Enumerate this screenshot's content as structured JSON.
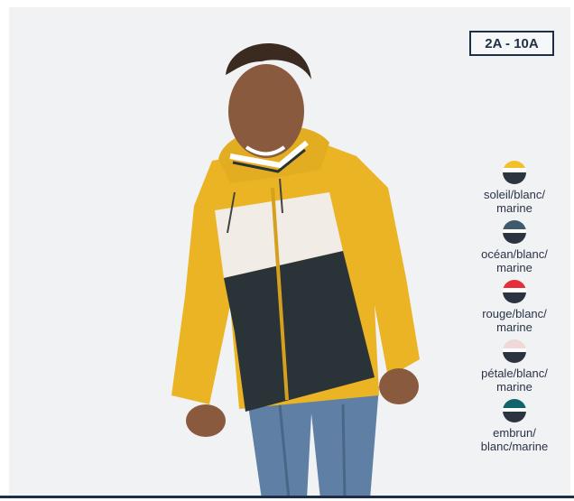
{
  "badge": {
    "size_range": "2A - 10A"
  },
  "colors": {
    "navy": "#1e2e45",
    "yellow": "#f2c12a",
    "slate": "#3f5a6b",
    "red": "#e5303a",
    "petal": "#f1d8d8",
    "teal": "#11646a"
  },
  "variants": [
    {
      "label_line1": "soleil/blanc/",
      "label_line2": "marine",
      "top": "#f2c12a"
    },
    {
      "label_line1": "océan/blanc/",
      "label_line2": "marine",
      "top": "#3f5a6b"
    },
    {
      "label_line1": "rouge/blanc/",
      "label_line2": "marine",
      "top": "#e5303a"
    },
    {
      "label_line1": "pétale/blanc/",
      "label_line2": "marine",
      "top": "#f1d8d8"
    },
    {
      "label_line1": "embrun/",
      "label_line2": "blanc/marine",
      "top": "#11646a"
    }
  ]
}
